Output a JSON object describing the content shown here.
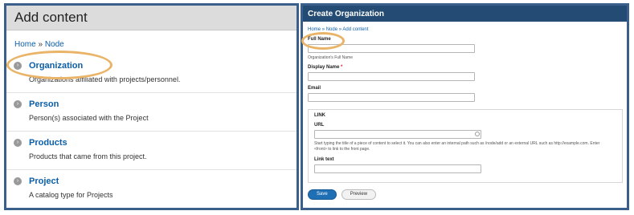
{
  "left": {
    "header_title": "Add content",
    "breadcrumb": [
      "Home",
      "Node"
    ],
    "breadcrumb_sep": "»",
    "items": [
      {
        "title": "Organization",
        "desc": "Organizations affiliated with projects/personnel."
      },
      {
        "title": "Person",
        "desc": "Person(s) associated with the Project"
      },
      {
        "title": "Products",
        "desc": "Products that came from this project."
      },
      {
        "title": "Project",
        "desc": "A catalog type for Projects"
      }
    ]
  },
  "right": {
    "header_title": "Create Organization",
    "breadcrumb": [
      "Home",
      "Node",
      "Add content"
    ],
    "breadcrumb_sep": "»",
    "full_name_label": "Full Name",
    "full_name_help": "Organization's Full Name",
    "display_name_label": "Display Name",
    "required_mark": "*",
    "email_label": "Email",
    "link_legend": "LINK",
    "url_label": "URL",
    "url_help": "Start typing the title of a piece of content to select it. You can also enter an internal path such as /node/add or an external URL such as http://example.com. Enter <front> to link to the front page.",
    "link_text_label": "Link text",
    "save_label": "Save",
    "preview_label": "Preview"
  },
  "colors": {
    "frame_border": "#3a5f8a",
    "highlight": "#e9b468",
    "right_header_bg": "#244b73",
    "link_blue": "#0b5ea8",
    "save_button": "#1f6fb5"
  },
  "icons": {
    "item_bullet": "chevron-circle-right-icon",
    "url_throbber": "autocomplete-throbber-icon"
  }
}
